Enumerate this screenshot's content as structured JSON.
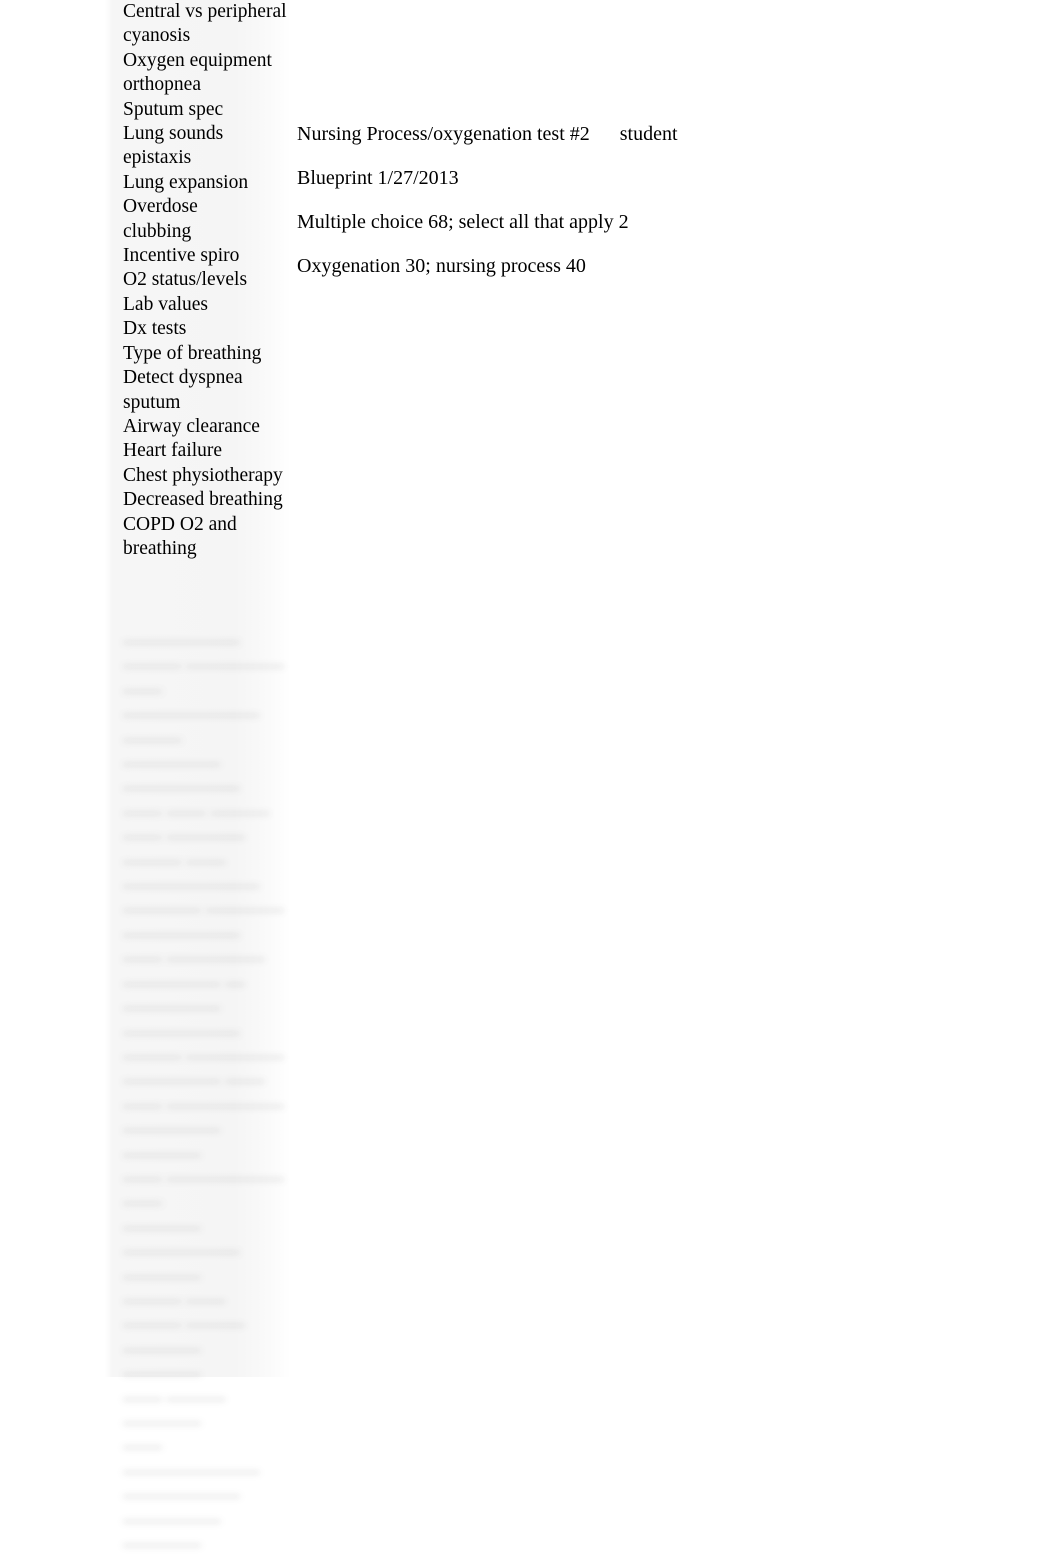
{
  "document": {
    "background_color": "#ffffff",
    "column_band_color": "#f5f5f5",
    "text_color": "#000000",
    "blurred_text_color": "#9a9a9a"
  },
  "topic_column": {
    "name": "oxygenation-topic-list",
    "items": [
      "Central vs peripheral cyanosis",
      "Oxygen equipment",
      "orthopnea",
      "Sputum spec",
      "Lung sounds",
      "epistaxis",
      "Lung expansion",
      "Overdose",
      "clubbing",
      "Incentive spiro",
      "O2 status/levels",
      "Lab values",
      "Dx tests",
      "Type of breathing",
      "Detect dyspnea",
      "sputum",
      "Airway clearance",
      "Heart failure",
      "Chest physiotherapy",
      "Decreased breathing",
      "COPD O2 and breathing"
    ]
  },
  "topic_column_blurred": {
    "name": "blurred-topic-list-continuation",
    "legible": false,
    "items": [
      "——————",
      "——— —————",
      "——",
      "———————",
      "———",
      "—————",
      "——————",
      "—— —— ———",
      "—— ————",
      "——— ——",
      "———————",
      "———— ————",
      "——————",
      "—— —————",
      "————— — —————",
      "——————",
      "——— —————",
      "————— ——",
      "—— ——————",
      "————— ————",
      "—— ——————",
      "——",
      "————",
      "—————— ————",
      "——— ——",
      "——— ——— ————",
      "————",
      "—— ——— ————",
      "—— ———————",
      "——————",
      "————— ————"
    ]
  },
  "header_block": {
    "name": "test-blueprint-header",
    "lines": [
      "Nursing Process/oxygenation test #2  student",
      "Blueprint 1/27/2013",
      "Multiple choice 68; select all that apply 2",
      "Oxygenation 30; nursing process 40"
    ]
  }
}
